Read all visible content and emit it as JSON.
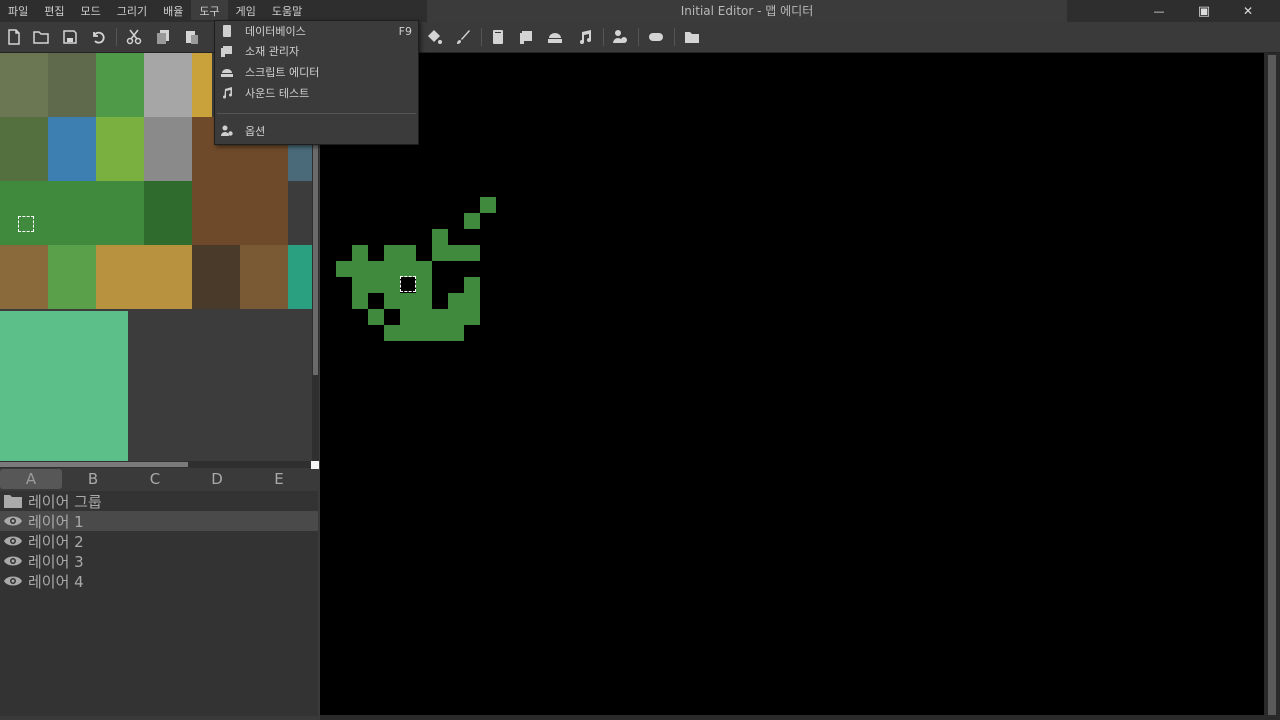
{
  "window": {
    "title": "Initial Editor - 맵 에디터",
    "minimize_symbol": "—",
    "maximize_symbol": "▣",
    "close_symbol": "✕"
  },
  "menu": [
    "파일",
    "편집",
    "모드",
    "그리기",
    "배율",
    "도구",
    "게임",
    "도움말"
  ],
  "tools_menu": {
    "items": [
      {
        "label": "데이터베이스",
        "shortcut": "F9",
        "icon": "database-icon"
      },
      {
        "label": "소재 관리자",
        "shortcut": "",
        "icon": "scroll-icon"
      },
      {
        "label": "스크립트 에디터",
        "shortcut": "",
        "icon": "script-editor-icon"
      },
      {
        "label": "사운드 테스트",
        "shortcut": "",
        "icon": "music-note-icon"
      },
      {
        "label": "옵션",
        "shortcut": "",
        "icon": "user-gear-icon"
      }
    ]
  },
  "toolbar": {
    "buttons": [
      "new-file-icon",
      "open-folder-icon",
      "save-icon",
      "undo-icon",
      "cut-icon",
      "copy-icon",
      "paste-icon",
      "paint-bucket-icon",
      "brush-icon",
      "database-icon",
      "scroll-icon",
      "script-editor-icon",
      "music-note-icon",
      "user-gear-icon",
      "gamepad-icon",
      "open-project-folder-icon"
    ]
  },
  "tileset_tabs": [
    "A",
    "B",
    "C",
    "D",
    "E"
  ],
  "active_tab": "A",
  "layers": {
    "group": "레이어 그룹",
    "items": [
      "레이어 1",
      "레이어 2",
      "레이어 3",
      "레이어 4"
    ],
    "selected": "레이어 1"
  },
  "colors": {
    "grass": "#3f8a3c",
    "canvas": "#000000",
    "panel": "#3a3a3a"
  }
}
